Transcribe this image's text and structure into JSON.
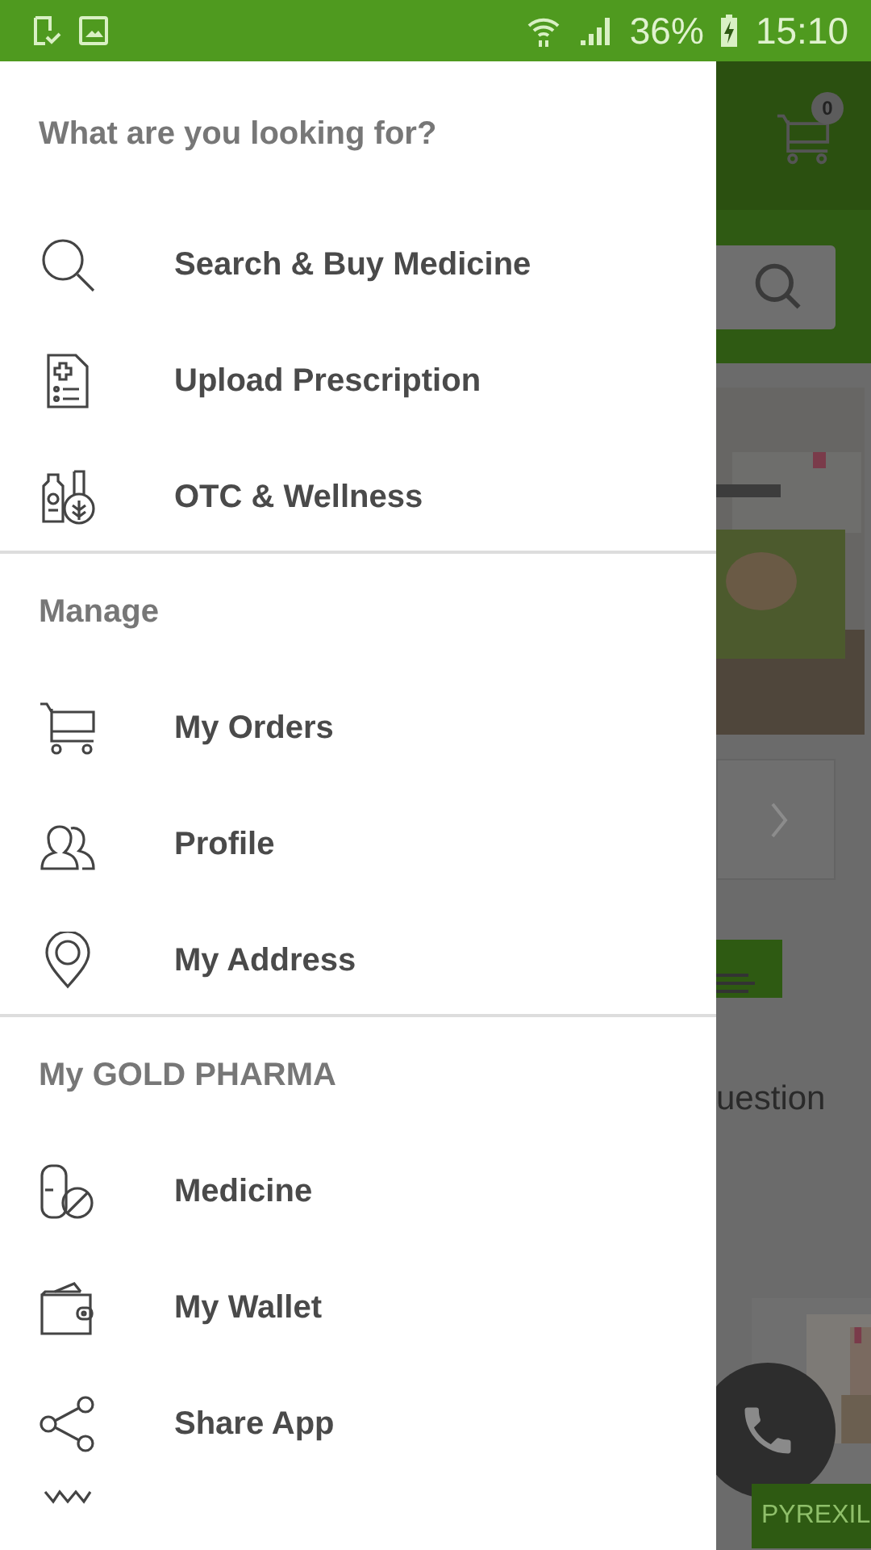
{
  "status_bar": {
    "battery": "36%",
    "time": "15:10"
  },
  "drawer": {
    "sections": [
      {
        "title": "What are you looking for?",
        "items": [
          {
            "label": "Search & Buy Medicine"
          },
          {
            "label": "Upload Prescription"
          },
          {
            "label": "OTC & Wellness"
          }
        ]
      },
      {
        "title": "Manage",
        "items": [
          {
            "label": "My Orders"
          },
          {
            "label": "Profile"
          },
          {
            "label": "My Address"
          }
        ]
      },
      {
        "title": "My GOLD PHARMA",
        "items": [
          {
            "label": "Medicine"
          },
          {
            "label": "My Wallet"
          },
          {
            "label": "Share App"
          }
        ]
      }
    ]
  },
  "background": {
    "cart_count": "0",
    "search_text": "uestion",
    "product_label": "PYREXIL"
  }
}
